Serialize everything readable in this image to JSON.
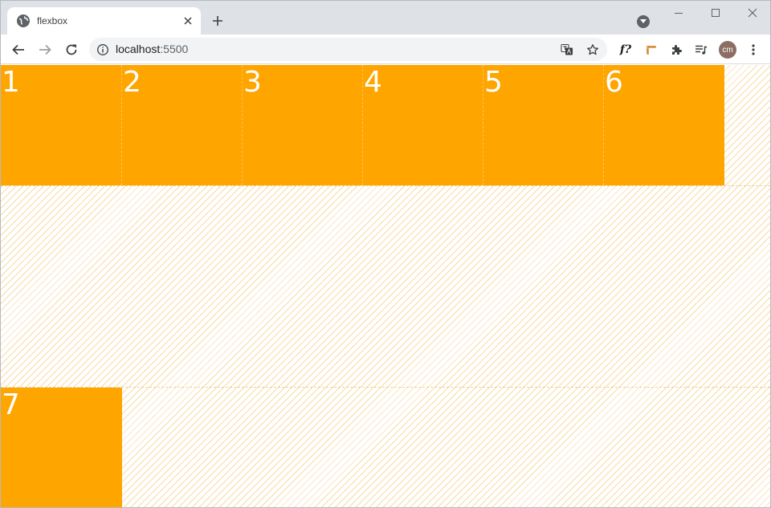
{
  "browser": {
    "tab": {
      "title": "flexbox"
    },
    "address": {
      "host": "localhost",
      "port": ":5500"
    },
    "profile": {
      "initials": "cm"
    },
    "extensions": {
      "font_ext_label": "f?"
    },
    "colors": {
      "tabstrip": "#dee1e6",
      "toolbar": "#ffffff",
      "omnibox": "#f1f3f4",
      "avatar": "#8d6e63"
    }
  },
  "page": {
    "items": [
      {
        "label": "1"
      },
      {
        "label": "2"
      },
      {
        "label": "3"
      },
      {
        "label": "4"
      },
      {
        "label": "5"
      },
      {
        "label": "6"
      },
      {
        "label": "7"
      }
    ],
    "colors": {
      "item_bg": "#ffa500",
      "item_text": "#ffffff"
    }
  }
}
